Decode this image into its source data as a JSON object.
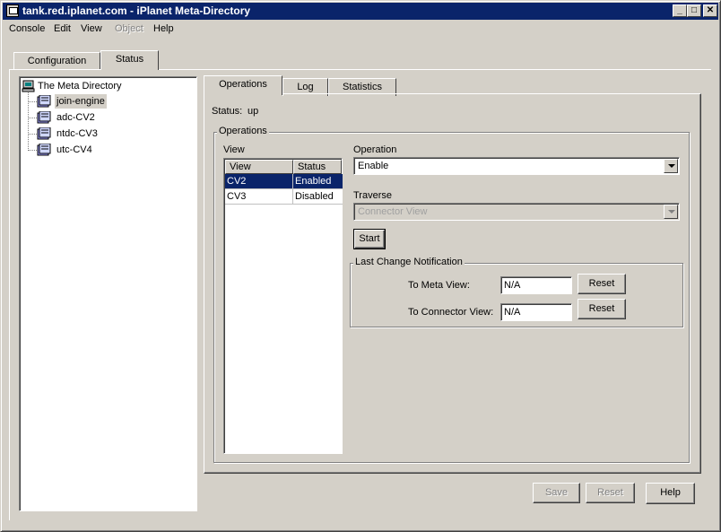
{
  "window": {
    "title": "tank.red.iplanet.com - iPlanet Meta-Directory"
  },
  "menu": {
    "items": [
      {
        "label": "Console",
        "disabled": false
      },
      {
        "label": "Edit",
        "disabled": false
      },
      {
        "label": "View",
        "disabled": false
      },
      {
        "label": "Object",
        "disabled": true
      },
      {
        "label": "Help",
        "disabled": false
      }
    ]
  },
  "top_tabs": [
    {
      "label": "Configuration",
      "active": false
    },
    {
      "label": "Status",
      "active": true
    }
  ],
  "tree": {
    "root": "The Meta Directory",
    "children": [
      {
        "label": "join-engine",
        "selected": true
      },
      {
        "label": "adc-CV2",
        "selected": false
      },
      {
        "label": "ntdc-CV3",
        "selected": false
      },
      {
        "label": "utc-CV4",
        "selected": false
      }
    ]
  },
  "sub_tabs": [
    {
      "label": "Operations",
      "active": true
    },
    {
      "label": "Log",
      "active": false
    },
    {
      "label": "Statistics",
      "active": false
    }
  ],
  "status": {
    "label": "Status:",
    "value": "up"
  },
  "operations_group": {
    "legend": "Operations",
    "view_label": "View",
    "columns": [
      "View",
      "Status"
    ],
    "rows": [
      {
        "view": "CV2",
        "status": "Enabled",
        "selected": true
      },
      {
        "view": "CV3",
        "status": "Disabled",
        "selected": false
      }
    ],
    "operation_label": "Operation",
    "operation_value": "Enable",
    "traverse_label": "Traverse",
    "traverse_value": "Connector View",
    "start_label": "Start"
  },
  "notification": {
    "legend": "Last Change Notification",
    "meta_label": "To Meta View:",
    "meta_value": "N/A",
    "connector_label": "To Connector View:",
    "connector_value": "N/A",
    "reset_label": "Reset"
  },
  "footer": {
    "save_label": "Save",
    "reset_label": "Reset",
    "help_label": "Help"
  },
  "colors": {
    "face": "#d4d0c8",
    "title_bar": "#0a246a",
    "selection": "#0a246a"
  }
}
